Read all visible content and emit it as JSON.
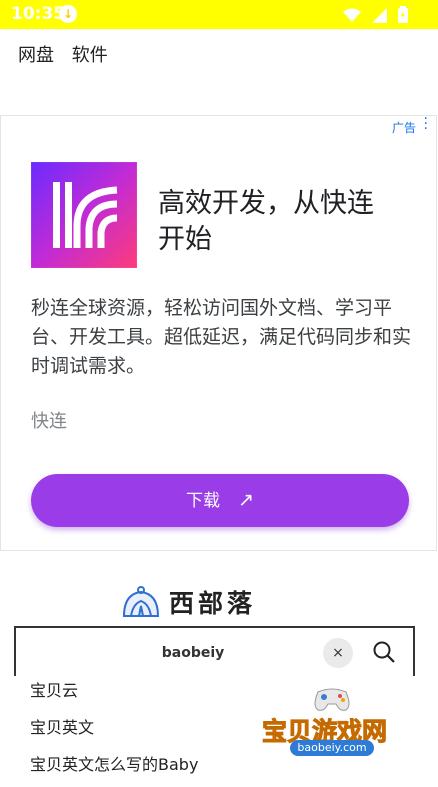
{
  "status_bar": {
    "time": "10:35"
  },
  "top_nav": {
    "items": [
      "网盘",
      "软件"
    ]
  },
  "ad": {
    "label": "广告",
    "headline": "高效开发，从快连开始",
    "description": "秒连全球资源，轻松访问国外文档、学习平台、开发工具。超低延迟，满足代码同步和实时调试需求。",
    "brand": "快连",
    "cta_label": "下载",
    "colors": {
      "cta": "#9a3ce8",
      "label": "#1a73e8"
    }
  },
  "site": {
    "name": "西部落"
  },
  "search": {
    "value": "baobeiy",
    "clear_label": "×"
  },
  "suggestions": [
    "宝贝云",
    "宝贝英文",
    "宝贝英文怎么写的Baby"
  ],
  "watermark": {
    "text": "宝贝游戏网",
    "url": "baobeiy.com"
  }
}
